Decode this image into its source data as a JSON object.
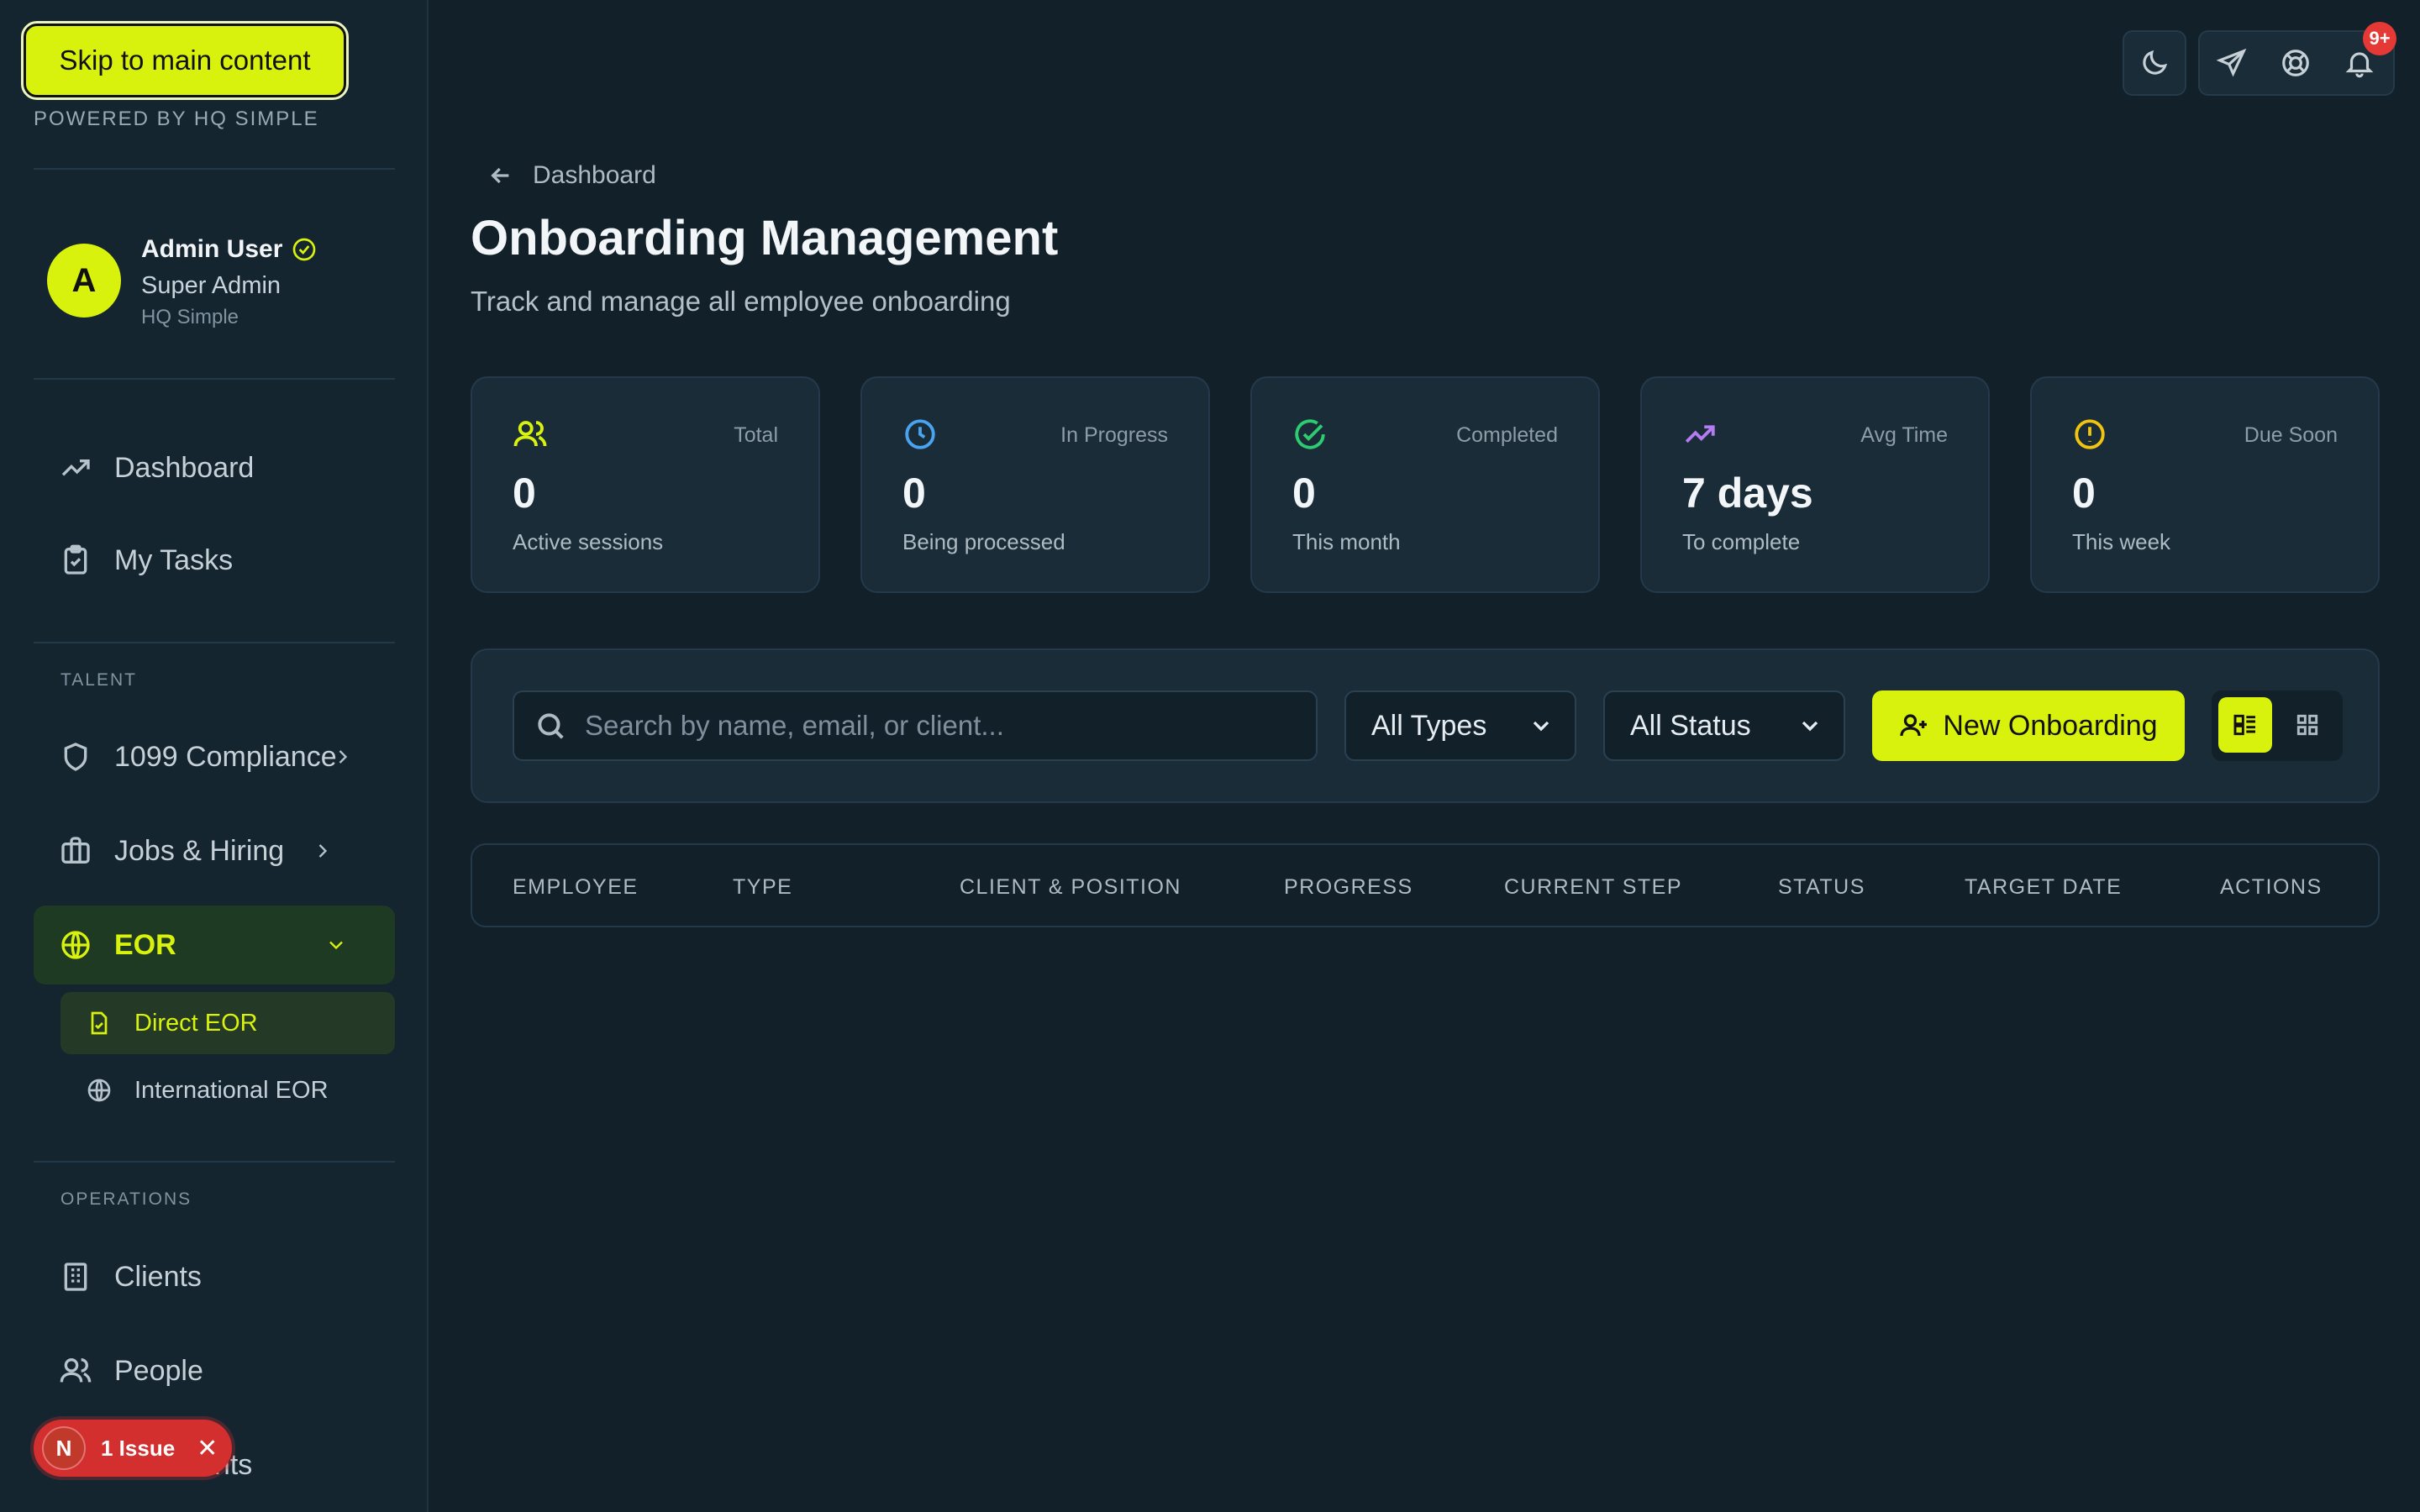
{
  "skip_link": "Skip to main content",
  "powered_by": "POWERED BY HQ SIMPLE",
  "user": {
    "initial": "A",
    "name": "Admin User",
    "role": "Super Admin",
    "org": "HQ Simple"
  },
  "nav": {
    "dashboard": "Dashboard",
    "my_tasks": "My Tasks",
    "section_talent": "TALENT",
    "compliance": "1099 Compliance",
    "jobs": "Jobs & Hiring",
    "eor": "EOR",
    "direct_eor": "Direct EOR",
    "international_eor": "International EOR",
    "section_operations": "OPERATIONS",
    "clients": "Clients",
    "people": "People",
    "partial_item": "ents"
  },
  "issue": {
    "initial": "N",
    "label": "1 Issue"
  },
  "notifications": {
    "count": "9+"
  },
  "main": {
    "back_label": "Dashboard",
    "title": "Onboarding Management",
    "subtitle": "Track and manage all employee onboarding"
  },
  "stats": [
    {
      "label": "Total",
      "value": "0",
      "desc": "Active sessions",
      "icon": "users-icon",
      "color": "#d8f20e"
    },
    {
      "label": "In Progress",
      "value": "0",
      "desc": "Being processed",
      "icon": "clock-icon",
      "color": "#4aa3f0"
    },
    {
      "label": "Completed",
      "value": "0",
      "desc": "This month",
      "icon": "check-circle-icon",
      "color": "#2ecc71"
    },
    {
      "label": "Avg Time",
      "value": "7 days",
      "desc": "To complete",
      "icon": "trending-up-icon",
      "color": "#b47cf0"
    },
    {
      "label": "Due Soon",
      "value": "0",
      "desc": "This week",
      "icon": "alert-circle-icon",
      "color": "#f1c40f"
    }
  ],
  "filters": {
    "search_placeholder": "Search by name, email, or client...",
    "type_select": "All Types",
    "status_select": "All Status",
    "new_button": "New Onboarding"
  },
  "table": {
    "columns": [
      "EMPLOYEE",
      "TYPE",
      "CLIENT & POSITION",
      "PROGRESS",
      "CURRENT STEP",
      "STATUS",
      "TARGET DATE",
      "ACTIONS"
    ]
  },
  "colors": {
    "accent": "#d8f20e",
    "background": "#12202a",
    "danger": "#e53935"
  }
}
